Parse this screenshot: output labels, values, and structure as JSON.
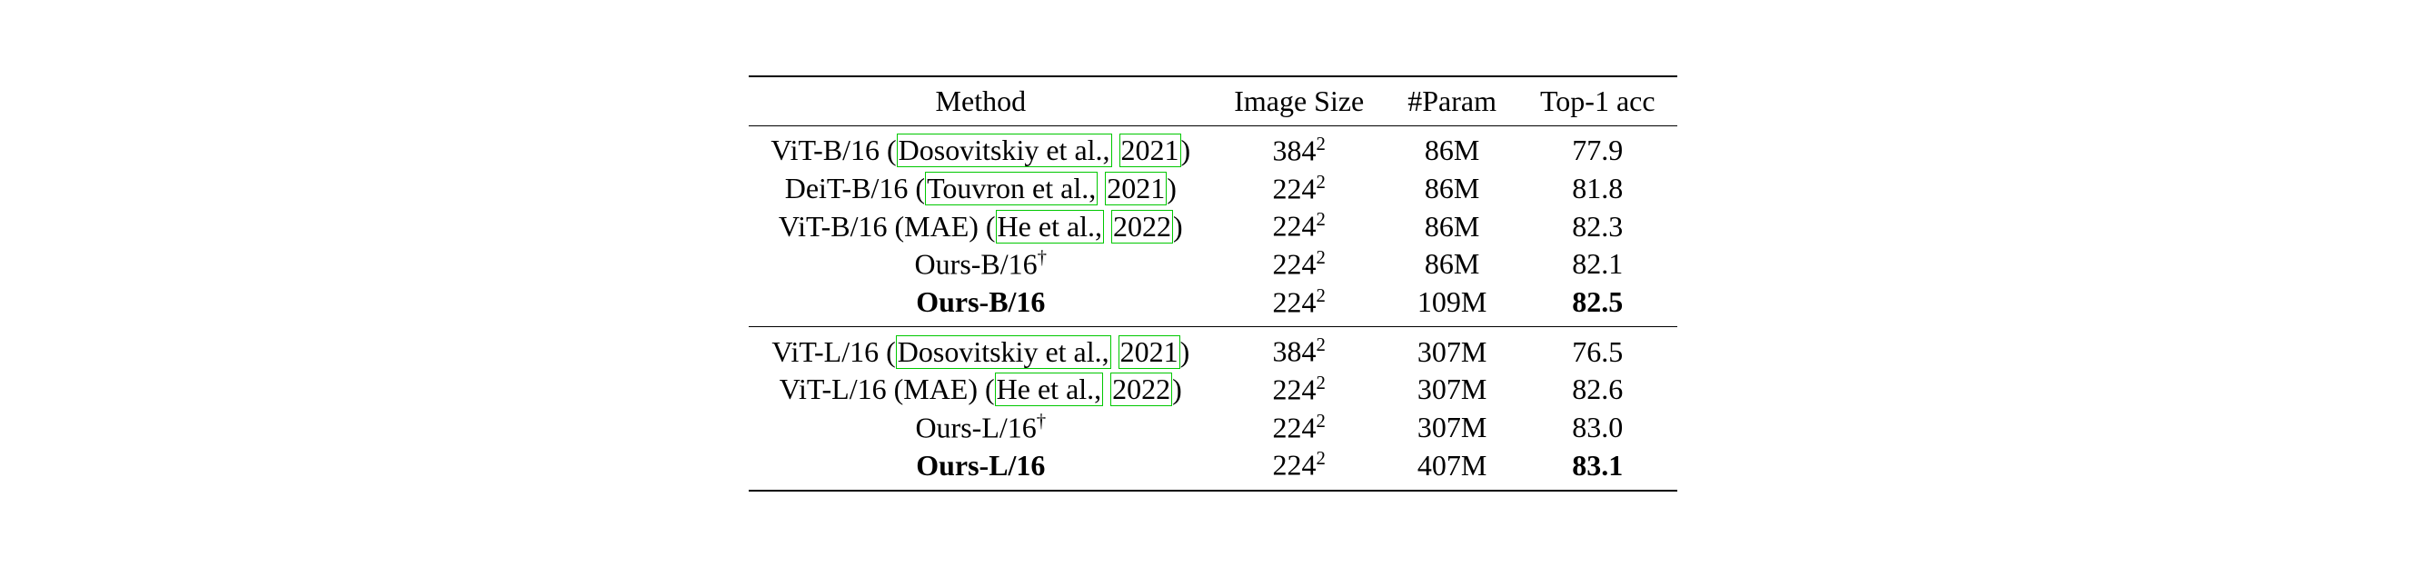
{
  "headers": {
    "method": "Method",
    "image_size": "Image Size",
    "param": "#Param",
    "top1": "Top-1 acc"
  },
  "chart_data": {
    "type": "table",
    "columns": [
      "Method",
      "Image Size",
      "#Param",
      "Top-1 acc"
    ],
    "groups": [
      [
        {
          "method": "ViT-B/16 (Dosovitskiy et al., 2021)",
          "image_size": "384^2",
          "param": "86M",
          "top1": 77.9,
          "bold": false
        },
        {
          "method": "DeiT-B/16 (Touvron et al., 2021)",
          "image_size": "224^2",
          "param": "86M",
          "top1": 81.8,
          "bold": false
        },
        {
          "method": "ViT-B/16 (MAE) (He et al., 2022)",
          "image_size": "224^2",
          "param": "86M",
          "top1": 82.3,
          "bold": false
        },
        {
          "method": "Ours-B/16†",
          "image_size": "224^2",
          "param": "86M",
          "top1": 82.1,
          "bold": false
        },
        {
          "method": "Ours-B/16",
          "image_size": "224^2",
          "param": "109M",
          "top1": 82.5,
          "bold": true
        }
      ],
      [
        {
          "method": "ViT-L/16 (Dosovitskiy et al., 2021)",
          "image_size": "384^2",
          "param": "307M",
          "top1": 76.5,
          "bold": false
        },
        {
          "method": "ViT-L/16 (MAE) (He et al., 2022)",
          "image_size": "224^2",
          "param": "307M",
          "top1": 82.6,
          "bold": false
        },
        {
          "method": "Ours-L/16†",
          "image_size": "224^2",
          "param": "307M",
          "top1": 83.0,
          "bold": false
        },
        {
          "method": "Ours-L/16",
          "image_size": "224^2",
          "param": "407M",
          "top1": 83.1,
          "bold": true
        }
      ]
    ]
  },
  "rows": {
    "g1r1": {
      "method_pre": "ViT-B/16 (",
      "cite_auth": "Dosovitskiy et al.,",
      "cite_year": "2021",
      "method_post": ")",
      "size_base": "384",
      "param": "86M",
      "top1": "77.9"
    },
    "g1r2": {
      "method_pre": "DeiT-B/16 (",
      "cite_auth": "Touvron et al.,",
      "cite_year": "2021",
      "method_post": ")",
      "size_base": "224",
      "param": "86M",
      "top1": "81.8"
    },
    "g1r3": {
      "method_pre": "ViT-B/16 (MAE) (",
      "cite_auth": "He et al.,",
      "cite_year": "2022",
      "method_post": ")",
      "size_base": "224",
      "param": "86M",
      "top1": "82.3"
    },
    "g1r4": {
      "method_name": "Ours-B/16",
      "size_base": "224",
      "param": "86M",
      "top1": "82.1"
    },
    "g1r5": {
      "method_name": "Ours-B/16",
      "size_base": "224",
      "param": "109M",
      "top1": "82.5"
    },
    "g2r1": {
      "method_pre": "ViT-L/16 (",
      "cite_auth": "Dosovitskiy et al.,",
      "cite_year": "2021",
      "method_post": ")",
      "size_base": "384",
      "param": "307M",
      "top1": "76.5"
    },
    "g2r2": {
      "method_pre": "ViT-L/16 (MAE) (",
      "cite_auth": "He et al.,",
      "cite_year": "2022",
      "method_post": ")",
      "size_base": "224",
      "param": "307M",
      "top1": "82.6"
    },
    "g2r3": {
      "method_name": "Ours-L/16",
      "size_base": "224",
      "param": "307M",
      "top1": "83.0"
    },
    "g2r4": {
      "method_name": "Ours-L/16",
      "size_base": "224",
      "param": "407M",
      "top1": "83.1"
    }
  },
  "sq": "2",
  "dagger": "†"
}
